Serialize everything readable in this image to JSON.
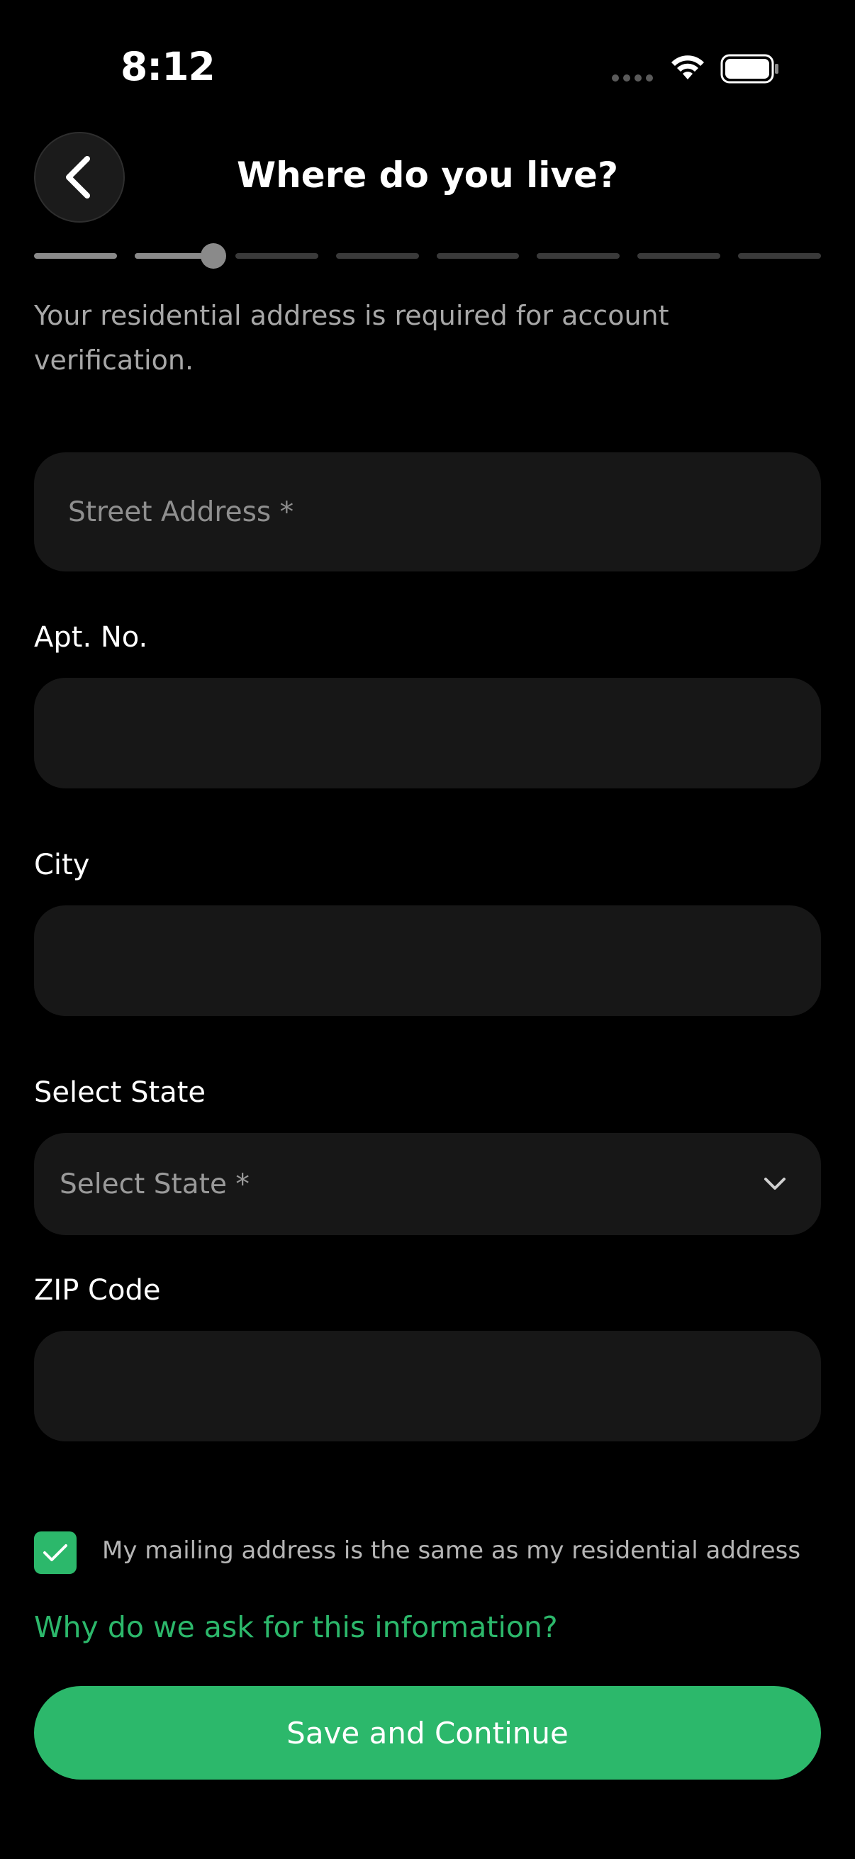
{
  "status_bar": {
    "time": "8:12",
    "icons": [
      "signal-dots-icon",
      "wifi-icon",
      "battery-icon"
    ]
  },
  "header": {
    "title": "Where do you live?",
    "back_icon": "chevron-left-icon"
  },
  "progress": {
    "total_steps": 8,
    "current_step": 2,
    "current_step_fraction": 0.95
  },
  "subtitle": "Your residential address is required for account verification.",
  "form": {
    "street_address": {
      "label": "",
      "value": "",
      "placeholder": "Street Address *"
    },
    "apt_no": {
      "label": "Apt. No.",
      "value": "",
      "placeholder": ""
    },
    "city": {
      "label": "City",
      "value": "",
      "placeholder": ""
    },
    "state": {
      "label": "Select State",
      "value": "Select State *",
      "icon": "chevron-down-icon"
    },
    "zip": {
      "label": "ZIP Code",
      "value": "",
      "placeholder": ""
    }
  },
  "mailing_checkbox": {
    "checked": true,
    "label": "My mailing address is the same as my residential address"
  },
  "info_link": "Why do we ask for this information?",
  "primary_button": "Save and Continue",
  "colors": {
    "background": "#000000",
    "field_bg": "#171717",
    "accent": "#2cb86b",
    "muted_text": "#a7a7a7"
  }
}
